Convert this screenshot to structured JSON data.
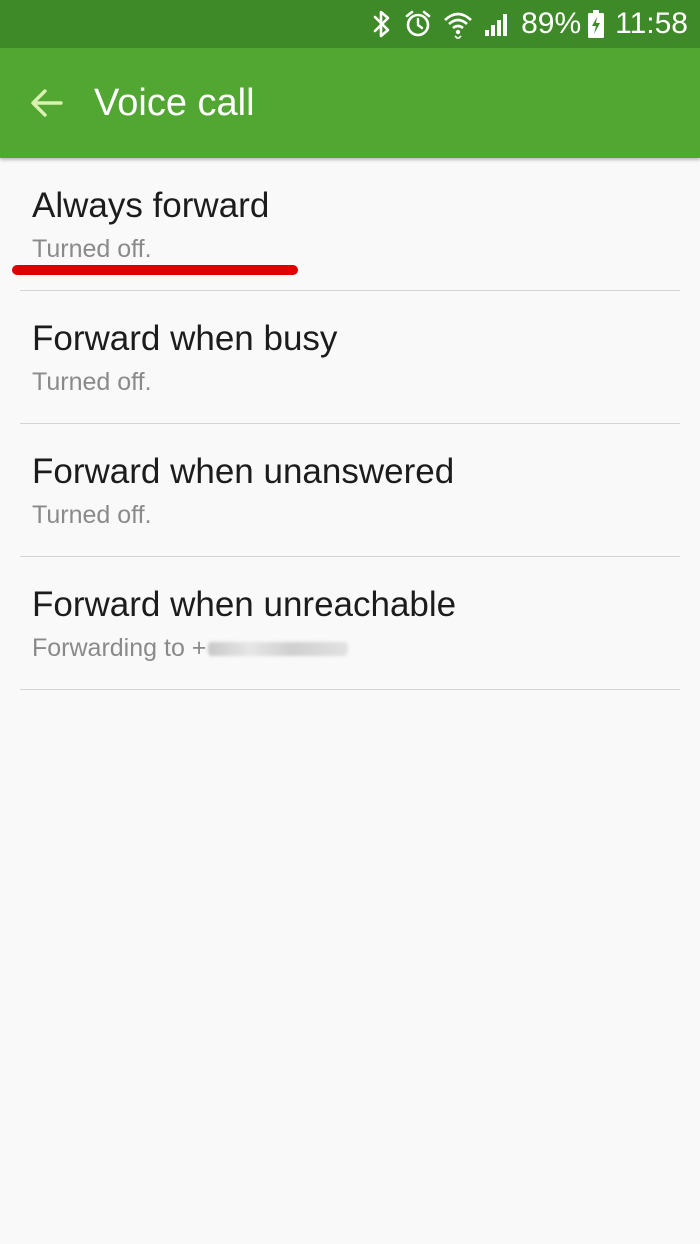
{
  "status_bar": {
    "battery_percent": "89%",
    "time": "11:58",
    "icons": [
      "bluetooth-icon",
      "alarm-icon",
      "wifi-icon",
      "signal-icon",
      "battery-charging-icon"
    ]
  },
  "header": {
    "title": "Voice call",
    "back_icon": "arrow-left-icon"
  },
  "colors": {
    "status_bar": "#3f8a28",
    "action_bar": "#52a732",
    "background": "#f9f9f9",
    "annotation": "#e00000"
  },
  "items": [
    {
      "title": "Always forward",
      "summary": "Turned off."
    },
    {
      "title": "Forward when busy",
      "summary": "Turned off."
    },
    {
      "title": "Forward when unanswered",
      "summary": "Turned off."
    },
    {
      "title": "Forward when unreachable",
      "summary": "Forwarding to +"
    }
  ]
}
